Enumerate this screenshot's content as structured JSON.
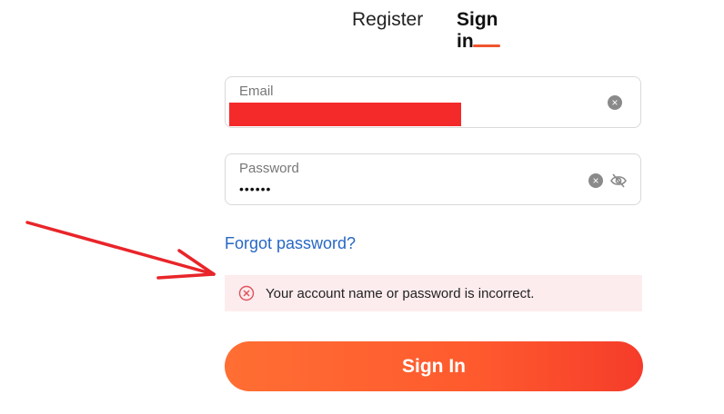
{
  "tabs": {
    "register": "Register",
    "sign_in": "Sign in"
  },
  "form": {
    "email_label": "Email",
    "password_label": "Password",
    "password_value": "••••••",
    "forgot_link": "Forgot password?",
    "error_message": "Your account name or password is incorrect.",
    "submit_label": "Sign In"
  },
  "icons": {
    "clear": "clear-icon",
    "eye_hidden": "eye-off-icon",
    "error": "error-circle-icon"
  },
  "colors": {
    "accent": "#f0552f",
    "link": "#2767c4",
    "error_bg": "#fdecee",
    "annotation": "#e8252a"
  }
}
